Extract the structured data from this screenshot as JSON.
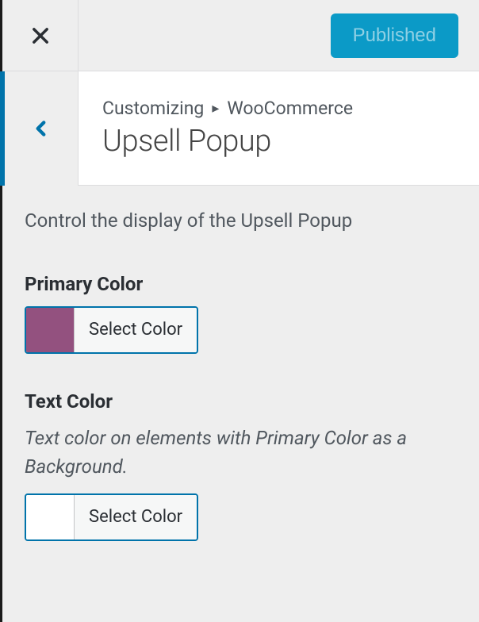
{
  "topbar": {
    "published_label": "Published"
  },
  "header": {
    "breadcrumb_root": "Customizing",
    "breadcrumb_parent": "WooCommerce",
    "section_title": "Upsell Popup"
  },
  "content": {
    "description": "Control the display of the Upsell Popup",
    "primary_color": {
      "label": "Primary Color",
      "button_label": "Select Color",
      "value": "#93517f"
    },
    "text_color": {
      "label": "Text Color",
      "help": "Text color on elements with Primary Color as a Background.",
      "button_label": "Select Color",
      "value": "#ffffff"
    }
  }
}
